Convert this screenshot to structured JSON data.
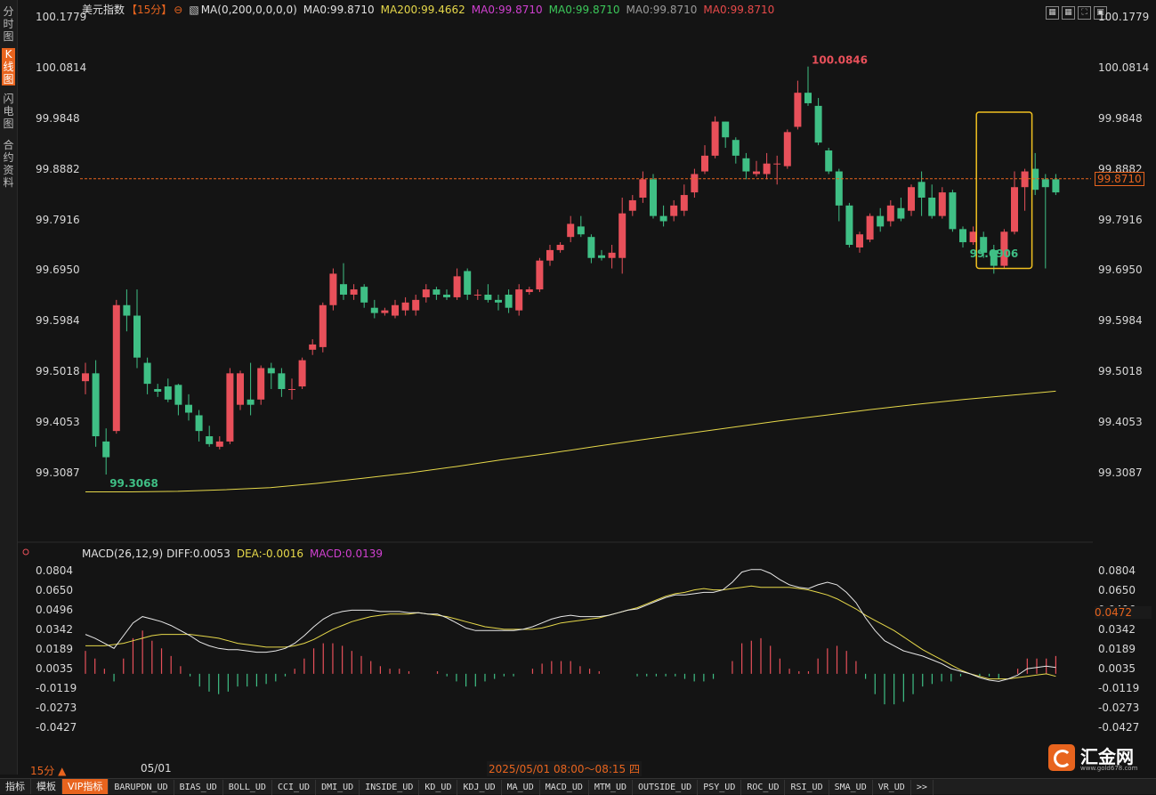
{
  "left_tabs": [
    "分时图",
    "K线图",
    "闪电图",
    "合约资料"
  ],
  "header": {
    "symbol": "美元指数",
    "period_tag": "【15分】",
    "ma_params": "MA(0,200,0,0,0,0)",
    "ma_values": [
      {
        "text": "MA0:99.8710",
        "color": "#e0e0e0"
      },
      {
        "text": "MA200:99.4662",
        "color": "#e6d84a"
      },
      {
        "text": "MA0:99.8710",
        "color": "#d040d0"
      },
      {
        "text": "MA0:99.8710",
        "color": "#3cc85a"
      },
      {
        "text": "MA0:99.8710",
        "color": "#9a9a9a"
      },
      {
        "text": "MA0:99.8710",
        "color": "#e84a4a"
      }
    ]
  },
  "macd_header": {
    "label": "MACD(26,12,9)",
    "diff": "DIFF:0.0053",
    "dea": "DEA:-0.0016",
    "macd": "MACD:0.0139"
  },
  "current_price": "99.8710",
  "current_macd": "0.0472",
  "high_label": "100.0846",
  "low_labels": [
    "99.3068",
    "99.6906"
  ],
  "bottom": {
    "period": "15分",
    "date": "05/01",
    "time_range": "2025/05/01 08:00～08:15 四",
    "tabs": [
      "指标",
      "模板",
      "VIP指标",
      "BARUPDN_UD",
      "BIAS_UD",
      "BOLL_UD",
      "CCI_UD",
      "DMI_UD",
      "INSIDE_UD",
      "KD_UD",
      "KDJ_UD",
      "MA_UD",
      "MACD_UD",
      "MTM_UD",
      "OUTSIDE_UD",
      "PSY_UD",
      "ROC_UD",
      "RSI_UD",
      "SMA_UD",
      "VR_UD",
      ">>"
    ]
  },
  "logo": {
    "name": "汇金网",
    "url": "www.gold678.com"
  },
  "colors": {
    "up": "#e8505a",
    "down": "#3fbf85",
    "ma200": "#e6d84a",
    "diff": "#e8e8e8",
    "dea": "#e6d84a",
    "accent": "#e8641e",
    "highlight": "#f0c020"
  },
  "chart_data": [
    {
      "type": "candlestick",
      "title": "美元指数 15分",
      "y_ticks": [
        "100.1779",
        "100.0814",
        "99.9848",
        "99.8882",
        "99.7916",
        "99.6950",
        "99.5984",
        "99.5018",
        "99.4053",
        "99.3087"
      ],
      "ylim": [
        99.2765,
        100.1779
      ],
      "candles": [
        [
          99.485,
          99.5,
          99.52,
          99.46
        ],
        [
          99.5,
          99.38,
          99.525,
          99.36
        ],
        [
          99.37,
          99.34,
          99.395,
          99.307
        ],
        [
          99.39,
          99.63,
          99.64,
          99.385
        ],
        [
          99.63,
          99.61,
          99.66,
          99.58
        ],
        [
          99.61,
          99.53,
          99.66,
          99.51
        ],
        [
          99.52,
          99.48,
          99.53,
          99.46
        ],
        [
          99.47,
          99.465,
          99.48,
          99.455
        ],
        [
          99.475,
          99.45,
          99.49,
          99.445
        ],
        [
          99.478,
          99.44,
          99.48,
          99.42
        ],
        [
          99.44,
          99.425,
          99.46,
          99.41
        ],
        [
          99.42,
          99.39,
          99.43,
          99.37
        ],
        [
          99.38,
          99.365,
          99.4,
          99.36
        ],
        [
          99.36,
          99.37,
          99.38,
          99.355
        ],
        [
          99.37,
          99.5,
          99.51,
          99.365
        ],
        [
          99.44,
          99.5,
          99.505,
          99.43
        ],
        [
          99.45,
          99.44,
          99.52,
          99.42
        ],
        [
          99.45,
          99.51,
          99.515,
          99.44
        ],
        [
          99.51,
          99.5,
          99.52,
          99.47
        ],
        [
          99.5,
          99.47,
          99.51,
          99.455
        ],
        [
          99.47,
          99.47,
          99.49,
          99.45
        ],
        [
          99.475,
          99.525,
          99.53,
          99.47
        ],
        [
          99.545,
          99.555,
          99.565,
          99.535
        ],
        [
          99.55,
          99.63,
          99.635,
          99.54
        ],
        [
          99.63,
          99.69,
          99.7,
          99.62
        ],
        [
          99.67,
          99.65,
          99.71,
          99.64
        ],
        [
          99.65,
          99.66,
          99.67,
          99.64
        ],
        [
          99.665,
          99.635,
          99.67,
          99.625
        ],
        [
          99.625,
          99.615,
          99.64,
          99.605
        ],
        [
          99.615,
          99.62,
          99.625,
          99.61
        ],
        [
          99.61,
          99.63,
          99.64,
          99.605
        ],
        [
          99.62,
          99.635,
          99.645,
          99.61
        ],
        [
          99.62,
          99.64,
          99.65,
          99.61
        ],
        [
          99.645,
          99.66,
          99.67,
          99.635
        ],
        [
          99.66,
          99.65,
          99.665,
          99.64
        ],
        [
          99.65,
          99.645,
          99.66,
          99.64
        ],
        [
          99.645,
          99.685,
          99.7,
          99.64
        ],
        [
          99.695,
          99.65,
          99.7,
          99.64
        ],
        [
          99.65,
          99.65,
          99.66,
          99.64
        ],
        [
          99.65,
          99.64,
          99.67,
          99.635
        ],
        [
          99.64,
          99.635,
          99.65,
          99.62
        ],
        [
          99.65,
          99.625,
          99.66,
          99.615
        ],
        [
          99.62,
          99.66,
          99.67,
          99.61
        ],
        [
          99.655,
          99.66,
          99.665,
          99.65
        ],
        [
          99.66,
          99.715,
          99.72,
          99.655
        ],
        [
          99.715,
          99.735,
          99.745,
          99.705
        ],
        [
          99.735,
          99.745,
          99.75,
          99.73
        ],
        [
          99.76,
          99.785,
          99.8,
          99.75
        ],
        [
          99.78,
          99.765,
          99.8,
          99.76
        ],
        [
          99.76,
          99.72,
          99.765,
          99.71
        ],
        [
          99.725,
          99.72,
          99.735,
          99.715
        ],
        [
          99.72,
          99.73,
          99.745,
          99.7
        ],
        [
          99.72,
          99.805,
          99.835,
          99.69
        ],
        [
          99.81,
          99.83,
          99.84,
          99.8
        ],
        [
          99.835,
          99.87,
          99.885,
          99.825
        ],
        [
          99.87,
          99.8,
          99.88,
          99.795
        ],
        [
          99.8,
          99.79,
          99.82,
          99.78
        ],
        [
          99.8,
          99.82,
          99.83,
          99.79
        ],
        [
          99.81,
          99.84,
          99.86,
          99.8
        ],
        [
          99.845,
          99.88,
          99.89,
          99.835
        ],
        [
          99.885,
          99.915,
          99.935,
          99.88
        ],
        [
          99.915,
          99.98,
          99.99,
          99.91
        ],
        [
          99.98,
          99.95,
          99.98,
          99.93
        ],
        [
          99.945,
          99.915,
          99.95,
          99.9
        ],
        [
          99.91,
          99.885,
          99.92,
          99.87
        ],
        [
          99.88,
          99.885,
          99.905,
          99.875
        ],
        [
          99.88,
          99.9,
          99.92,
          99.87
        ],
        [
          99.9,
          99.9,
          99.915,
          99.86
        ],
        [
          99.895,
          99.96,
          99.965,
          99.89
        ],
        [
          99.97,
          100.035,
          100.058,
          99.965
        ],
        [
          100.035,
          100.015,
          100.085,
          100.01
        ],
        [
          100.01,
          99.94,
          100.025,
          99.935
        ],
        [
          99.925,
          99.885,
          99.93,
          99.88
        ],
        [
          99.885,
          99.82,
          99.89,
          99.79
        ],
        [
          99.82,
          99.745,
          99.825,
          99.74
        ],
        [
          99.74,
          99.765,
          99.77,
          99.73
        ],
        [
          99.755,
          99.8,
          99.805,
          99.75
        ],
        [
          99.8,
          99.78,
          99.815,
          99.77
        ],
        [
          99.79,
          99.82,
          99.83,
          99.78
        ],
        [
          99.815,
          99.795,
          99.835,
          99.79
        ],
        [
          99.81,
          99.855,
          99.86,
          99.8
        ],
        [
          99.865,
          99.835,
          99.885,
          99.8
        ],
        [
          99.835,
          99.8,
          99.86,
          99.795
        ],
        [
          99.8,
          99.845,
          99.855,
          99.795
        ],
        [
          99.845,
          99.775,
          99.85,
          99.77
        ],
        [
          99.775,
          99.75,
          99.78,
          99.74
        ],
        [
          99.75,
          99.77,
          99.78,
          99.745
        ],
        [
          99.76,
          99.73,
          99.77,
          99.72
        ],
        [
          99.735,
          99.705,
          99.745,
          99.69
        ],
        [
          99.705,
          99.77,
          99.775,
          99.7
        ],
        [
          99.77,
          99.855,
          99.885,
          99.765
        ],
        [
          99.855,
          99.885,
          99.89,
          99.81
        ],
        [
          99.89,
          99.85,
          99.92,
          99.84
        ],
        [
          99.87,
          99.855,
          99.88,
          99.7
        ],
        [
          99.87,
          99.845,
          99.88,
          99.84
        ]
      ],
      "ma200": [
        99.274,
        99.274,
        99.275,
        99.278,
        99.282,
        99.29,
        99.3,
        99.31,
        99.322,
        99.335,
        99.347,
        99.36,
        99.373,
        99.385,
        99.397,
        99.409,
        99.42,
        99.431,
        99.441,
        99.45,
        99.458,
        99.466
      ],
      "highlight_box": {
        "from_candle": 87,
        "to_candle": 91
      }
    },
    {
      "type": "macd",
      "title": "MACD(26,12,9)",
      "y_ticks": [
        "0.0804",
        "0.0650",
        "0.0496",
        "0.0342",
        "0.0189",
        "0.0035",
        "-0.0119",
        "-0.0273",
        "-0.0427"
      ],
      "ylim": [
        -0.0505,
        0.086
      ],
      "diff": [
        0.031,
        0.028,
        0.024,
        0.02,
        0.03,
        0.04,
        0.045,
        0.043,
        0.041,
        0.038,
        0.034,
        0.03,
        0.025,
        0.022,
        0.02,
        0.019,
        0.019,
        0.018,
        0.017,
        0.017,
        0.018,
        0.02,
        0.024,
        0.03,
        0.037,
        0.043,
        0.047,
        0.049,
        0.05,
        0.05,
        0.05,
        0.049,
        0.049,
        0.049,
        0.048,
        0.048,
        0.047,
        0.047,
        0.044,
        0.04,
        0.036,
        0.034,
        0.034,
        0.034,
        0.034,
        0.034,
        0.035,
        0.037,
        0.04,
        0.043,
        0.045,
        0.046,
        0.045,
        0.045,
        0.045,
        0.046,
        0.048,
        0.05,
        0.051,
        0.054,
        0.057,
        0.06,
        0.062,
        0.062,
        0.063,
        0.064,
        0.064,
        0.066,
        0.072,
        0.08,
        0.082,
        0.082,
        0.079,
        0.074,
        0.07,
        0.068,
        0.067,
        0.07,
        0.072,
        0.07,
        0.064,
        0.056,
        0.044,
        0.034,
        0.026,
        0.022,
        0.018,
        0.016,
        0.014,
        0.011,
        0.008,
        0.004,
        0.002,
        0.0,
        -0.003,
        -0.005,
        -0.006,
        -0.004,
        -0.001,
        0.004,
        0.005,
        0.006,
        0.005
      ],
      "dea": [
        0.022,
        0.022,
        0.022,
        0.023,
        0.024,
        0.026,
        0.028,
        0.03,
        0.031,
        0.031,
        0.031,
        0.031,
        0.03,
        0.029,
        0.028,
        0.026,
        0.024,
        0.023,
        0.022,
        0.021,
        0.021,
        0.021,
        0.022,
        0.024,
        0.027,
        0.031,
        0.035,
        0.038,
        0.041,
        0.043,
        0.045,
        0.046,
        0.047,
        0.047,
        0.047,
        0.048,
        0.047,
        0.046,
        0.045,
        0.043,
        0.041,
        0.039,
        0.037,
        0.036,
        0.035,
        0.035,
        0.035,
        0.035,
        0.036,
        0.038,
        0.04,
        0.041,
        0.042,
        0.043,
        0.044,
        0.046,
        0.048,
        0.05,
        0.052,
        0.055,
        0.058,
        0.061,
        0.063,
        0.064,
        0.066,
        0.067,
        0.066,
        0.066,
        0.067,
        0.068,
        0.069,
        0.068,
        0.068,
        0.068,
        0.068,
        0.067,
        0.066,
        0.064,
        0.062,
        0.059,
        0.055,
        0.051,
        0.046,
        0.042,
        0.038,
        0.034,
        0.029,
        0.024,
        0.019,
        0.015,
        0.011,
        0.007,
        0.003,
        0.0,
        -0.002,
        -0.004,
        -0.004,
        -0.004,
        -0.003,
        -0.002,
        -0.001,
        0.0,
        -0.002
      ],
      "histogram_note": "bars = 2*(DIFF-DEA)"
    }
  ]
}
